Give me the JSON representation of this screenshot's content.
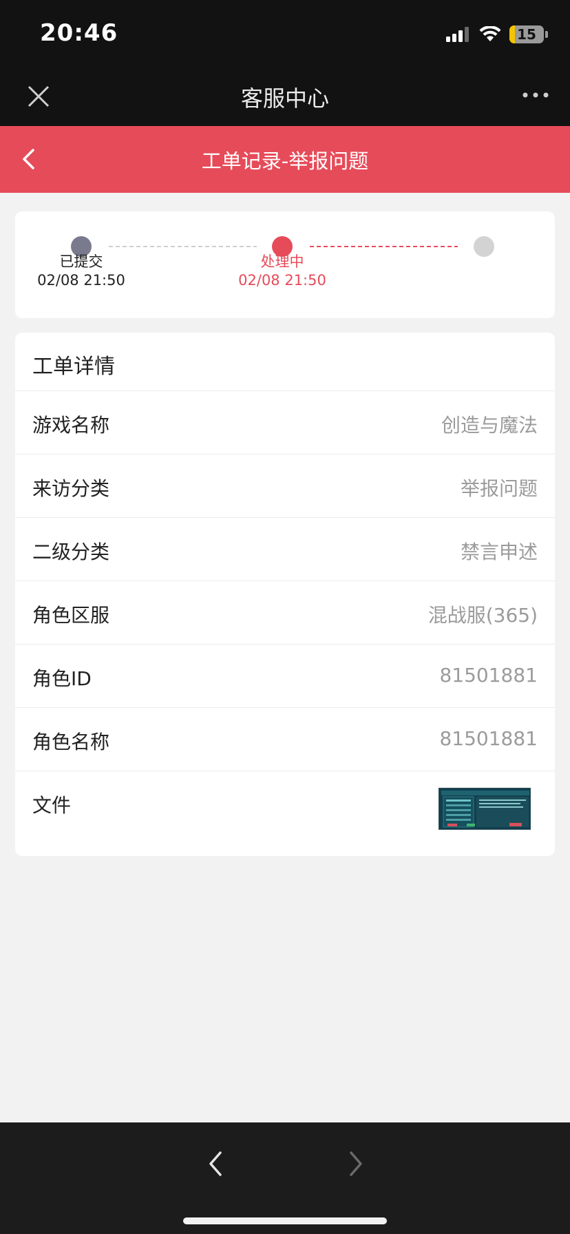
{
  "status_bar": {
    "time": "20:46",
    "battery": "15"
  },
  "nav": {
    "title": "客服中心",
    "close_icon": "close-icon",
    "more_icon": "more-icon"
  },
  "header": {
    "title": "工单记录-举报问题",
    "back_icon": "back-icon"
  },
  "progress": {
    "steps": [
      {
        "label": "已提交",
        "time": "02/08 21:50",
        "state": "done"
      },
      {
        "label": "处理中",
        "time": "02/08 21:50",
        "state": "active"
      },
      {
        "label": "",
        "time": "",
        "state": "pending"
      }
    ]
  },
  "details": {
    "title": "工单详情",
    "rows": [
      {
        "label": "游戏名称",
        "value": "创造与魔法"
      },
      {
        "label": "来访分类",
        "value": "举报问题"
      },
      {
        "label": "二级分类",
        "value": "禁言申述"
      },
      {
        "label": "角色区服",
        "value": "混战服(365)"
      },
      {
        "label": "角色ID",
        "value": "81501881"
      },
      {
        "label": "角色名称",
        "value": "81501881"
      },
      {
        "label": "文件",
        "value": ""
      }
    ]
  },
  "colors": {
    "accent": "#e64b59",
    "done_dot": "#7a7a8e",
    "pending_dot": "#d3d3d3"
  }
}
